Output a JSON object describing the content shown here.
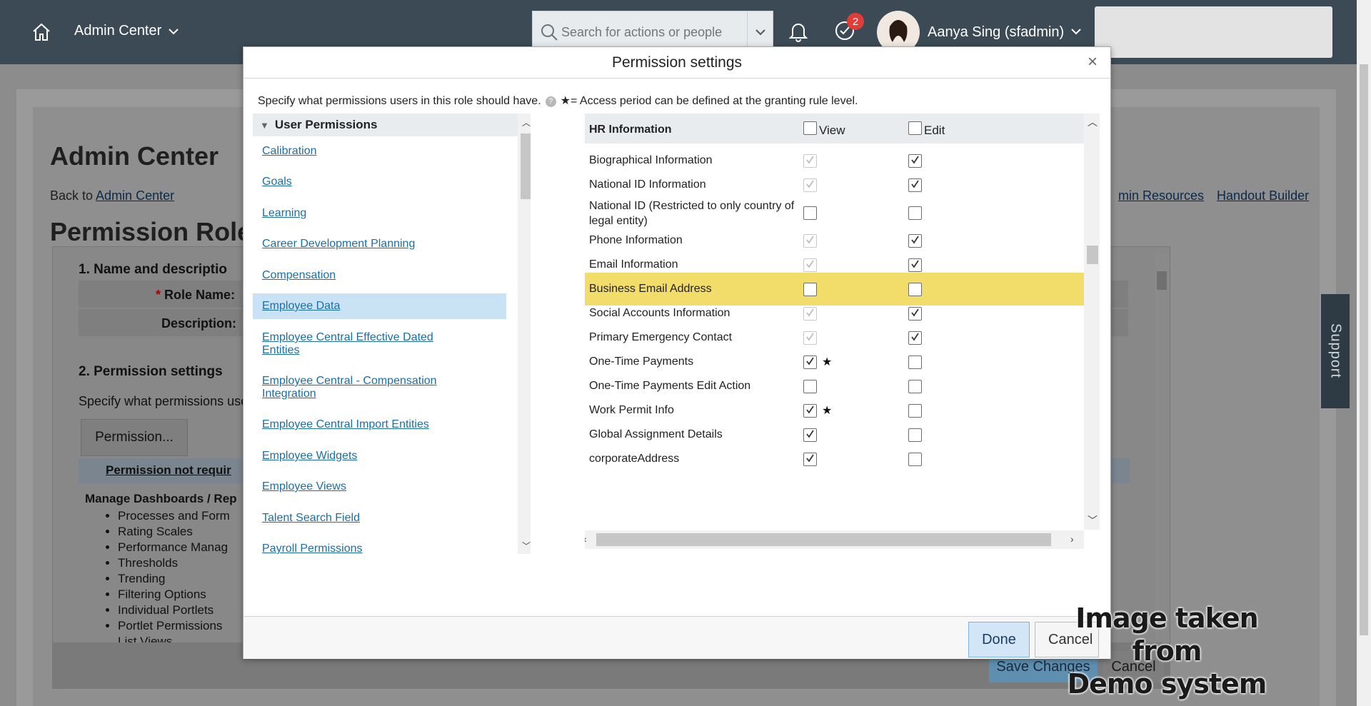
{
  "shell": {
    "app_title": "Admin Center",
    "search_placeholder": "Search for actions or people",
    "notifications_badge": "2",
    "user_name": "Aanya Sing (sfadmin)",
    "icons": [
      "home-icon",
      "chevron-down-icon",
      "search-icon",
      "bell-icon",
      "todo-check-icon",
      "avatar"
    ]
  },
  "page": {
    "title": "Admin Center",
    "back_to_label": "Back to",
    "back_to_link": "Admin Center",
    "subtitle": "Permission Role",
    "right_links": [
      "min Resources",
      "Handout Builder"
    ],
    "section1_title": "1. Name and descriptio",
    "role_name_label": "Role Name:",
    "description_label": "Description:",
    "section2_title": "2. Permission settings",
    "section2_text": "Specify what permissions use",
    "permission_button": "Permission...",
    "perm_not_required": "Permission not requir",
    "dash_title": "Manage Dashboards / Rep",
    "dash_items": [
      "Processes and Form",
      "Rating Scales",
      "Performance Manag",
      "Thresholds",
      "Trending",
      "Filtering Options",
      "Individual Portlets",
      "Portlet Permissions",
      "List Views"
    ],
    "save_changes": "Save Changes",
    "cancel": "Cancel",
    "support": "Support"
  },
  "modal": {
    "title": "Permission settings",
    "intro": "Specify what permissions users in this role should have.",
    "help_glyph": "?",
    "access_note": "★= Access period can be defined at the granting rule level.",
    "done_label": "Done",
    "cancel_label": "Cancel",
    "left_nav": {
      "header": "User Permissions",
      "items": [
        {
          "label": "Calibration",
          "selected": false
        },
        {
          "label": "Goals",
          "selected": false
        },
        {
          "label": "Learning",
          "selected": false
        },
        {
          "label": "Career Development Planning",
          "selected": false
        },
        {
          "label": "Compensation",
          "selected": false
        },
        {
          "label": "Employee Data",
          "selected": true
        },
        {
          "label": "Employee Central Effective Dated Entities",
          "selected": false
        },
        {
          "label": "Employee Central - Compensation Integration",
          "selected": false
        },
        {
          "label": "Employee Central Import Entities",
          "selected": false
        },
        {
          "label": "Employee Widgets",
          "selected": false
        },
        {
          "label": "Employee Views",
          "selected": false
        },
        {
          "label": "Talent Search Field",
          "selected": false
        },
        {
          "label": "Payroll Permissions",
          "selected": false
        }
      ]
    },
    "grid": {
      "section_header": "HR Information",
      "view_label": "View",
      "edit_label": "Edit",
      "star_glyph": "★",
      "rows": [
        {
          "label": "Biographical Information",
          "view": "checked-disabled",
          "view_star": false,
          "edit": "checked",
          "highlight": false
        },
        {
          "label": "National ID Information",
          "view": "checked-disabled",
          "view_star": false,
          "edit": "checked",
          "highlight": false
        },
        {
          "label": "National ID (Restricted to only country of legal entity)",
          "view": "unchecked",
          "view_star": false,
          "edit": "unchecked",
          "highlight": false
        },
        {
          "label": "Phone Information",
          "view": "checked-disabled",
          "view_star": false,
          "edit": "checked",
          "highlight": false
        },
        {
          "label": "Email Information",
          "view": "checked-disabled",
          "view_star": false,
          "edit": "checked",
          "highlight": false
        },
        {
          "label": "Business Email Address",
          "view": "unchecked",
          "view_star": false,
          "edit": "unchecked",
          "highlight": true
        },
        {
          "label": "Social Accounts Information",
          "view": "checked-disabled",
          "view_star": false,
          "edit": "checked",
          "highlight": false
        },
        {
          "label": "Primary Emergency Contact",
          "view": "checked-disabled",
          "view_star": false,
          "edit": "checked",
          "highlight": false
        },
        {
          "label": "One-Time Payments",
          "view": "checked",
          "view_star": true,
          "edit": "unchecked",
          "highlight": false
        },
        {
          "label": "One-Time Payments Edit Action",
          "view": "unchecked",
          "view_star": false,
          "edit": "unchecked",
          "highlight": false
        },
        {
          "label": "Work Permit Info",
          "view": "checked",
          "view_star": true,
          "edit": "unchecked",
          "highlight": false
        },
        {
          "label": "Global Assignment Details",
          "view": "checked",
          "view_star": false,
          "edit": "unchecked",
          "highlight": false
        },
        {
          "label": "corporateAddress",
          "view": "checked",
          "view_star": false,
          "edit": "unchecked",
          "highlight": false
        }
      ]
    }
  },
  "watermark": {
    "line1": "Image taken from",
    "line2": "Demo system"
  },
  "colors": {
    "shell_bg": "#3b4a55",
    "link": "#1b6ea8",
    "highlight": "#f2dd6b",
    "selected_nav": "#c9e3f5",
    "done_bg": "#d3e6f7"
  }
}
